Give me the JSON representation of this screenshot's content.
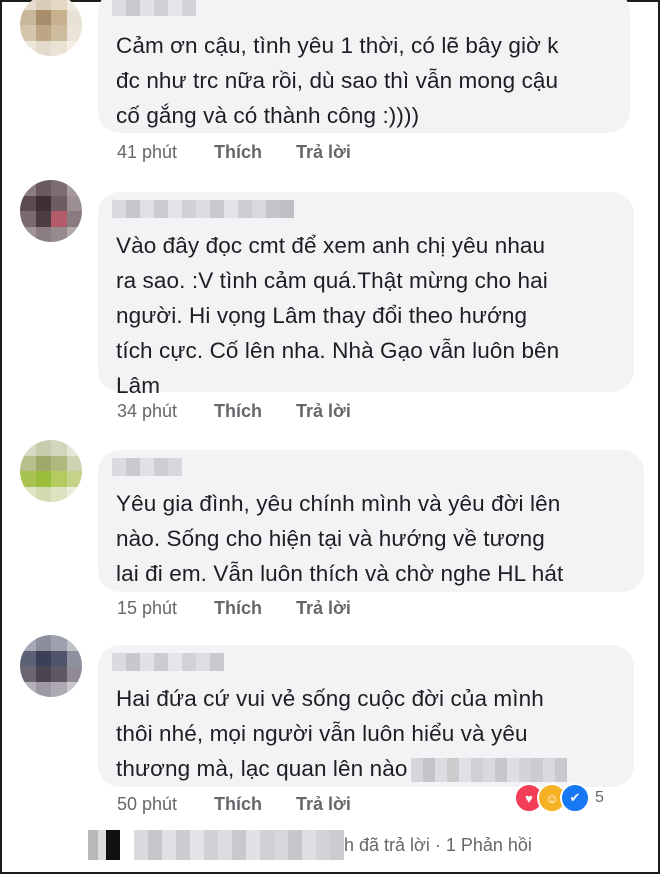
{
  "comments": [
    {
      "text": "Cảm ơn cậu, tình yêu 1 thời, có lẽ bây giờ k\nđc như trc nữa rồi, dù sao thì vẫn mong cậu\ncố gắng và có thành công :))))",
      "time": "41 phút",
      "like_label": "Thích",
      "reply_label": "Trả lời"
    },
    {
      "text": "Vào đây đọc cmt để xem anh chị yêu nhau\nra sao. :V tình cảm quá.Thật mừng cho hai\nngười. Hi vọng Lâm thay đổi theo hướng\ntích cực. Cố lên nha. Nhà Gạo vẫn luôn bên\nLâm",
      "time": "34 phút",
      "like_label": "Thích",
      "reply_label": "Trả lời"
    },
    {
      "text": "Yêu gia đình, yêu chính mình và yêu đời lên\nnào. Sống cho hiện tại và hướng về tương\nlai đi em. Vẫn luôn thích và chờ nghe HL hát",
      "time": "15 phút",
      "like_label": "Thích",
      "reply_label": "Trả lời"
    },
    {
      "text": "Hai đứa cứ vui vẻ sống cuộc đời của mình\nthôi nhé, mọi người vẫn luôn hiểu và yêu\nthương mà, lạc quan lên nào",
      "time": "50 phút",
      "like_label": "Thích",
      "reply_label": "Trả lời",
      "reactions": {
        "icons": [
          "love-icon",
          "haha-icon",
          "like-icon"
        ],
        "count": "5"
      }
    }
  ],
  "replies_summary": {
    "text": "h đã trả lời · 1 Phản hồi"
  },
  "colors": {
    "bubble": "#f2f3f5",
    "text": "#1c1e21",
    "meta": "#65676b"
  }
}
